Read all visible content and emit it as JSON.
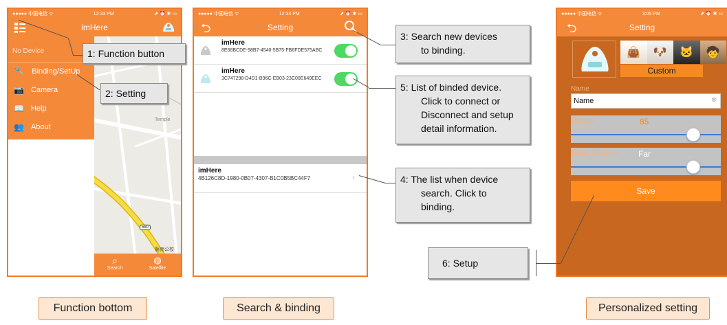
{
  "screen1": {
    "status": {
      "carrier": "●●●●● 中国电信 ᯤ",
      "time": "12:33 PM",
      "right": "⬈ ⏰ ✱ ▭"
    },
    "title": "imHere",
    "no_device": "No Device",
    "menu": [
      {
        "label": "Binding/SetUp",
        "icon": "wrench-icon"
      },
      {
        "label": "Camera",
        "icon": "camera-icon"
      },
      {
        "label": "Help",
        "icon": "book-icon"
      },
      {
        "label": "About",
        "icon": "people-icon"
      }
    ],
    "map_labels": {
      "temple": "Temple",
      "school": "藝南公校"
    },
    "tabs": {
      "search": "Search",
      "satellite": "Satellite"
    }
  },
  "screen2": {
    "status": {
      "carrier": "●●●●● 中国电信 ᯤ",
      "time": "12:34 PM",
      "right": "⬈ ⏰ ✱ ▭"
    },
    "title": "Setting",
    "devices": [
      {
        "name": "imHere",
        "id": "8E66BCDE-98B7-4540-5B75-FB6FDE575ABC",
        "on": true
      },
      {
        "name": "imHere",
        "id": "3C747298-D4D1-B96C-EB03-23C00E649EEC",
        "on": true
      }
    ],
    "found": {
      "name": "imHere",
      "id": "4B126C8D-1980-0B07-4307-B1C0B5BC44F7"
    }
  },
  "screen3": {
    "status": {
      "carrier": "●●●●● 中国电信 ᯤ",
      "time": "3:05 PM",
      "right": "⬈ ⏰ ✱ ▭"
    },
    "title": "Setting",
    "custom": "Custom",
    "name_label": "Name",
    "name_placeholder": "Name",
    "volume_label": "Volume",
    "volume_value": "85",
    "volume_level": 0.85,
    "alarm_label": "Alarm Distance",
    "alarm_value": "Far",
    "alarm_level": 0.85,
    "save": "Save"
  },
  "callouts": {
    "c1": "1: Function button",
    "c2": "2: Setting",
    "c3_lines": [
      "3:  Search new devices",
      "to binding."
    ],
    "c5_lines": [
      "5:  List of binded device.",
      "Click to connect or",
      "Disconnect and setup",
      "detail information."
    ],
    "c4_lines": [
      "4:  The list when device",
      "search. Click to",
      "binding."
    ],
    "c6": "6: Setup"
  },
  "captions": {
    "function": "Function bottom",
    "search": "Search & binding",
    "personal": "Personalized setting"
  },
  "colors": {
    "accent": "#f5893a",
    "toggle": "#4cd964"
  }
}
